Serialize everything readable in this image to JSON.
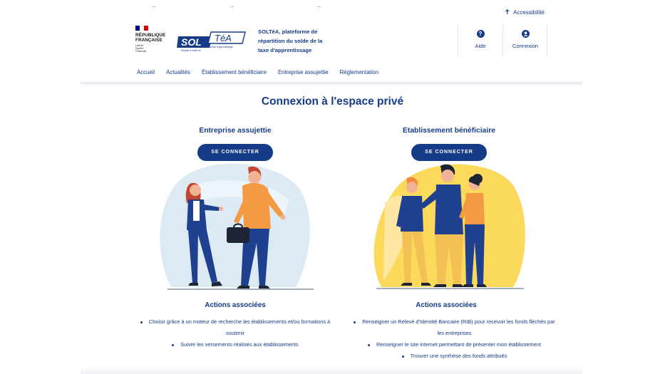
{
  "header": {
    "accessibility_label": "Accessibilité",
    "republique": {
      "title_line1": "RÉPUBLIQUE",
      "title_line2": "FRANÇAISE",
      "motto": [
        "Liberté",
        "Égalité",
        "Fraternité"
      ]
    },
    "soltea_logo": {
      "sol": "SOL",
      "tea": "TéA",
      "tagline_left": "Répartir le solde de",
      "tagline_right": "la taxe d'apprentissage"
    },
    "site_description_line1": "SOLTéA, plateforme de",
    "site_description_line2": "répartition du solde de la",
    "site_description_line3": "taxe d'apprentissage",
    "aide_label": "Aide",
    "connexion_label": "Connexion"
  },
  "nav": {
    "items": [
      {
        "label": "Accueil"
      },
      {
        "label": "Actualités"
      },
      {
        "label": "Établissement bénéficiaire"
      },
      {
        "label": "Entreprise assujettie"
      },
      {
        "label": "Réglementation"
      }
    ]
  },
  "main": {
    "title": "Connexion à l'espace privé",
    "columns": [
      {
        "title": "Entreprise assujettie",
        "button_label": "SE CONNECTER",
        "actions_title": "Actions associées",
        "actions": [
          "Choisir grâce à un moteur de recherche les établissements et/ou formations à soutenir",
          "Suivre les versements réalisés aux établissements"
        ]
      },
      {
        "title": "Etablissement bénéficiaire",
        "button_label": "SE CONNECTER",
        "actions_title": "Actions associées",
        "actions": [
          "Renseigner un Relevé d'Identité Bancaire (RIB) pour recevoir les fonds fléchés par les entreprises",
          "Renseigner le site internet permettant de présenter mon établissement",
          "Trouver une synthèse des fonds attribués"
        ]
      }
    ]
  },
  "colors": {
    "primary": "#163c88",
    "blob_left": "#dceaf3",
    "blob_right": "#fbd95a",
    "flag_blue": "#000091",
    "flag_red": "#e1000f"
  },
  "icons": {
    "accessibility": "person-icon",
    "aide": "question-circle-icon",
    "connexion": "user-circle-icon"
  }
}
